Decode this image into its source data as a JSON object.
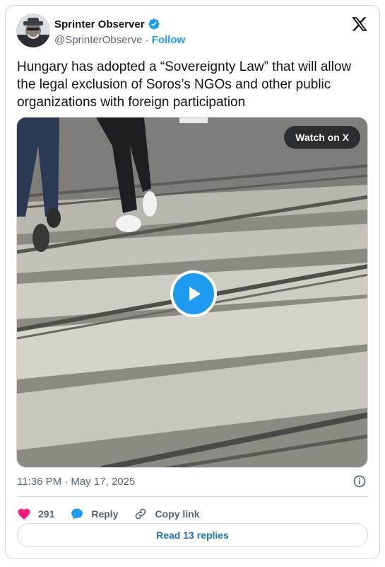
{
  "author": {
    "name": "Sprinter Observer",
    "handle": "@SprinterObserve",
    "separator": "·",
    "follow_label": "Follow"
  },
  "tweet": {
    "text": "Hungary has adopted a “Sovereignty Law” that will allow the legal exclusion of Soros’s NGOs and other public organizations with foreign participation"
  },
  "media": {
    "watch_label": "Watch on X"
  },
  "meta": {
    "timestamp": "11:36 PM · May 17, 2025"
  },
  "actions": {
    "likes_count": "291",
    "reply_label": "Reply",
    "copy_link_label": "Copy link"
  },
  "read_replies_label": "Read 13 replies",
  "colors": {
    "accent": "#1d9bf0",
    "like": "#f91880",
    "text_secondary": "#536471",
    "border": "#cfd9de"
  }
}
